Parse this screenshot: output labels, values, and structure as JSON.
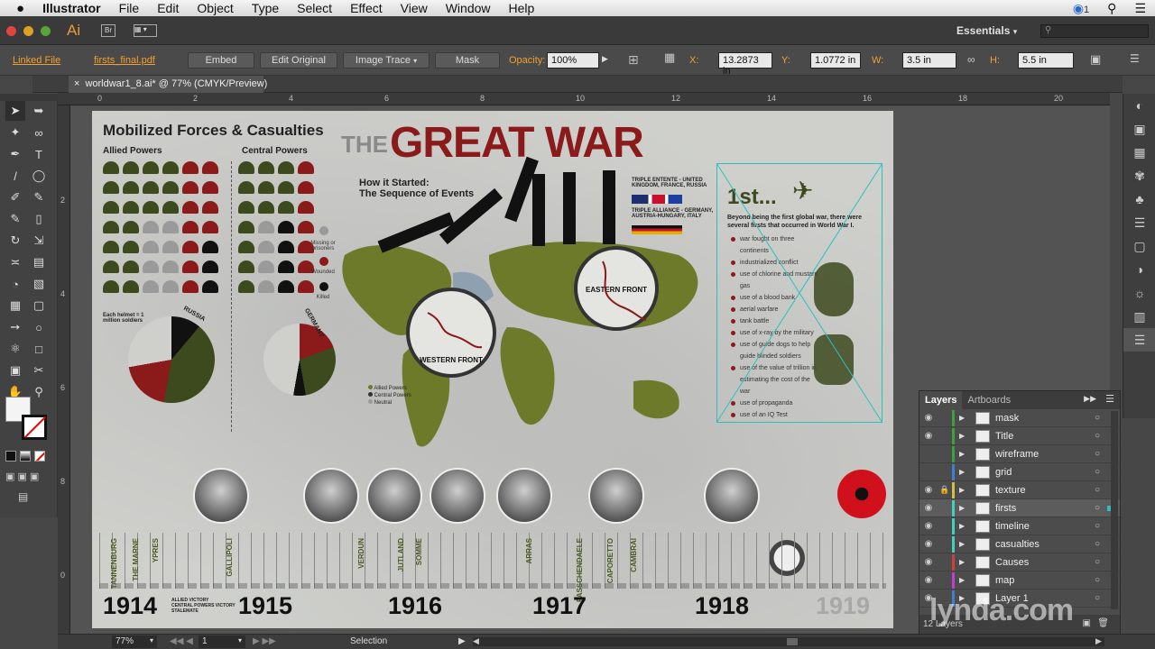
{
  "menubar": {
    "app_name": "Illustrator",
    "items": [
      "File",
      "Edit",
      "Object",
      "Type",
      "Select",
      "Effect",
      "View",
      "Window",
      "Help"
    ],
    "right_badge": "1"
  },
  "appbar": {
    "app_logo": "Ai",
    "bridge_label": "Br",
    "workspace": "Essentials",
    "search_placeholder": ""
  },
  "control_bar": {
    "linked_file": "Linked File",
    "file_name": "firsts_final.pdf",
    "embed": "Embed",
    "edit_original": "Edit Original",
    "image_trace": "Image Trace",
    "mask": "Mask",
    "opacity_label": "Opacity:",
    "opacity_value": "100%",
    "x_label": "X:",
    "x_value": "13.2873 in",
    "y_label": "Y:",
    "y_value": "1.0772 in",
    "w_label": "W:",
    "w_value": "3.5 in",
    "h_label": "H:",
    "h_value": "5.5 in"
  },
  "document": {
    "tab_title": "worldwar1_8.ai* @ 77% (CMYK/Preview)",
    "ruler_h": [
      "0",
      "2",
      "4",
      "6",
      "8",
      "10",
      "12",
      "14",
      "16",
      "18",
      "20"
    ],
    "ruler_v": [
      "2",
      "4",
      "6",
      "8",
      "0"
    ]
  },
  "artwork": {
    "forces_title": "Mobilized Forces & Casualties",
    "allied": "Allied Powers",
    "central": "Central Powers",
    "the": "THE",
    "great_war": "GREAT WAR",
    "how_started": "How it Started:",
    "sequence": "The Sequence of Events",
    "entente": "TRIPLE ENTENTE - UNITED KINGDOM, FRANCE, RUSSIA",
    "alliance": "TRIPLE ALLIANCE - GERMANY, AUSTRIA-HUNGARY, ITALY",
    "western_front": "WESTERN FRONT",
    "eastern_front": "EASTERN FRONT",
    "each_helmet": "Each helmet = 1 million soldiers",
    "russia": "RUSSIA",
    "germany": "GERMANY",
    "missing": "Missing or prisoners",
    "wounded": "Wounded",
    "killed": "Killed",
    "legend_allied": "Allied Powers",
    "legend_central": "Central Powers",
    "legend_neutral": "Neutral",
    "first_title": "1st...",
    "first_intro": "Beyond being the first global war, there were several firsts that occurred in World War I.",
    "firsts": [
      "war fought on three continents",
      "industrialized conflict",
      "use of chlorine and mustard gas",
      "use of a blood bank",
      "aerial warfare",
      "tank battle",
      "use of x-ray by the military",
      "use of guide dogs to help guide blinded soldiers",
      "use of the value of trillion in estimating the cost of the war",
      "use of propaganda",
      "use of an IQ Test"
    ],
    "years": [
      "1914",
      "1915",
      "1916",
      "1917",
      "1918",
      "1919"
    ],
    "battles": [
      "TANNENBURG",
      "THE MARNE",
      "YPRES",
      "GALLIPOLI",
      "VERDUN",
      "JUTLAND",
      "SOMME",
      "ARRAS",
      "PASSCHENDAELE",
      "CAPORETTO",
      "CAMBRAI"
    ],
    "timeline_legend": [
      "ALLIED VICTORY",
      "CENTRAL POWERS VICTORY",
      "STALEMATE"
    ]
  },
  "layers_panel": {
    "tab_layers": "Layers",
    "tab_artboards": "Artboards",
    "layers": [
      {
        "name": "mask",
        "color": "#3fa03f",
        "visible": true,
        "locked": false
      },
      {
        "name": "Title",
        "color": "#3fa03f",
        "visible": true,
        "locked": false
      },
      {
        "name": "wireframe",
        "color": "#3fa03f",
        "visible": false,
        "locked": false
      },
      {
        "name": "grid",
        "color": "#3f7fd0",
        "visible": false,
        "locked": false
      },
      {
        "name": "texture",
        "color": "#d0c03f",
        "visible": true,
        "locked": true
      },
      {
        "name": "firsts",
        "color": "#3fd0c0",
        "visible": true,
        "locked": false
      },
      {
        "name": "timeline",
        "color": "#3fd0c0",
        "visible": true,
        "locked": false
      },
      {
        "name": "casualties",
        "color": "#3fd0c0",
        "visible": true,
        "locked": false
      },
      {
        "name": "Causes",
        "color": "#d03f3f",
        "visible": true,
        "locked": false
      },
      {
        "name": "map",
        "color": "#c03fd0",
        "visible": true,
        "locked": false
      },
      {
        "name": "Layer 1",
        "color": "#3f7fd0",
        "visible": true,
        "locked": false
      }
    ],
    "footer_count": "12 Layers"
  },
  "statusbar": {
    "zoom": "77%",
    "artboard_num": "1",
    "tool": "Selection"
  },
  "watermark": "lynda.com"
}
